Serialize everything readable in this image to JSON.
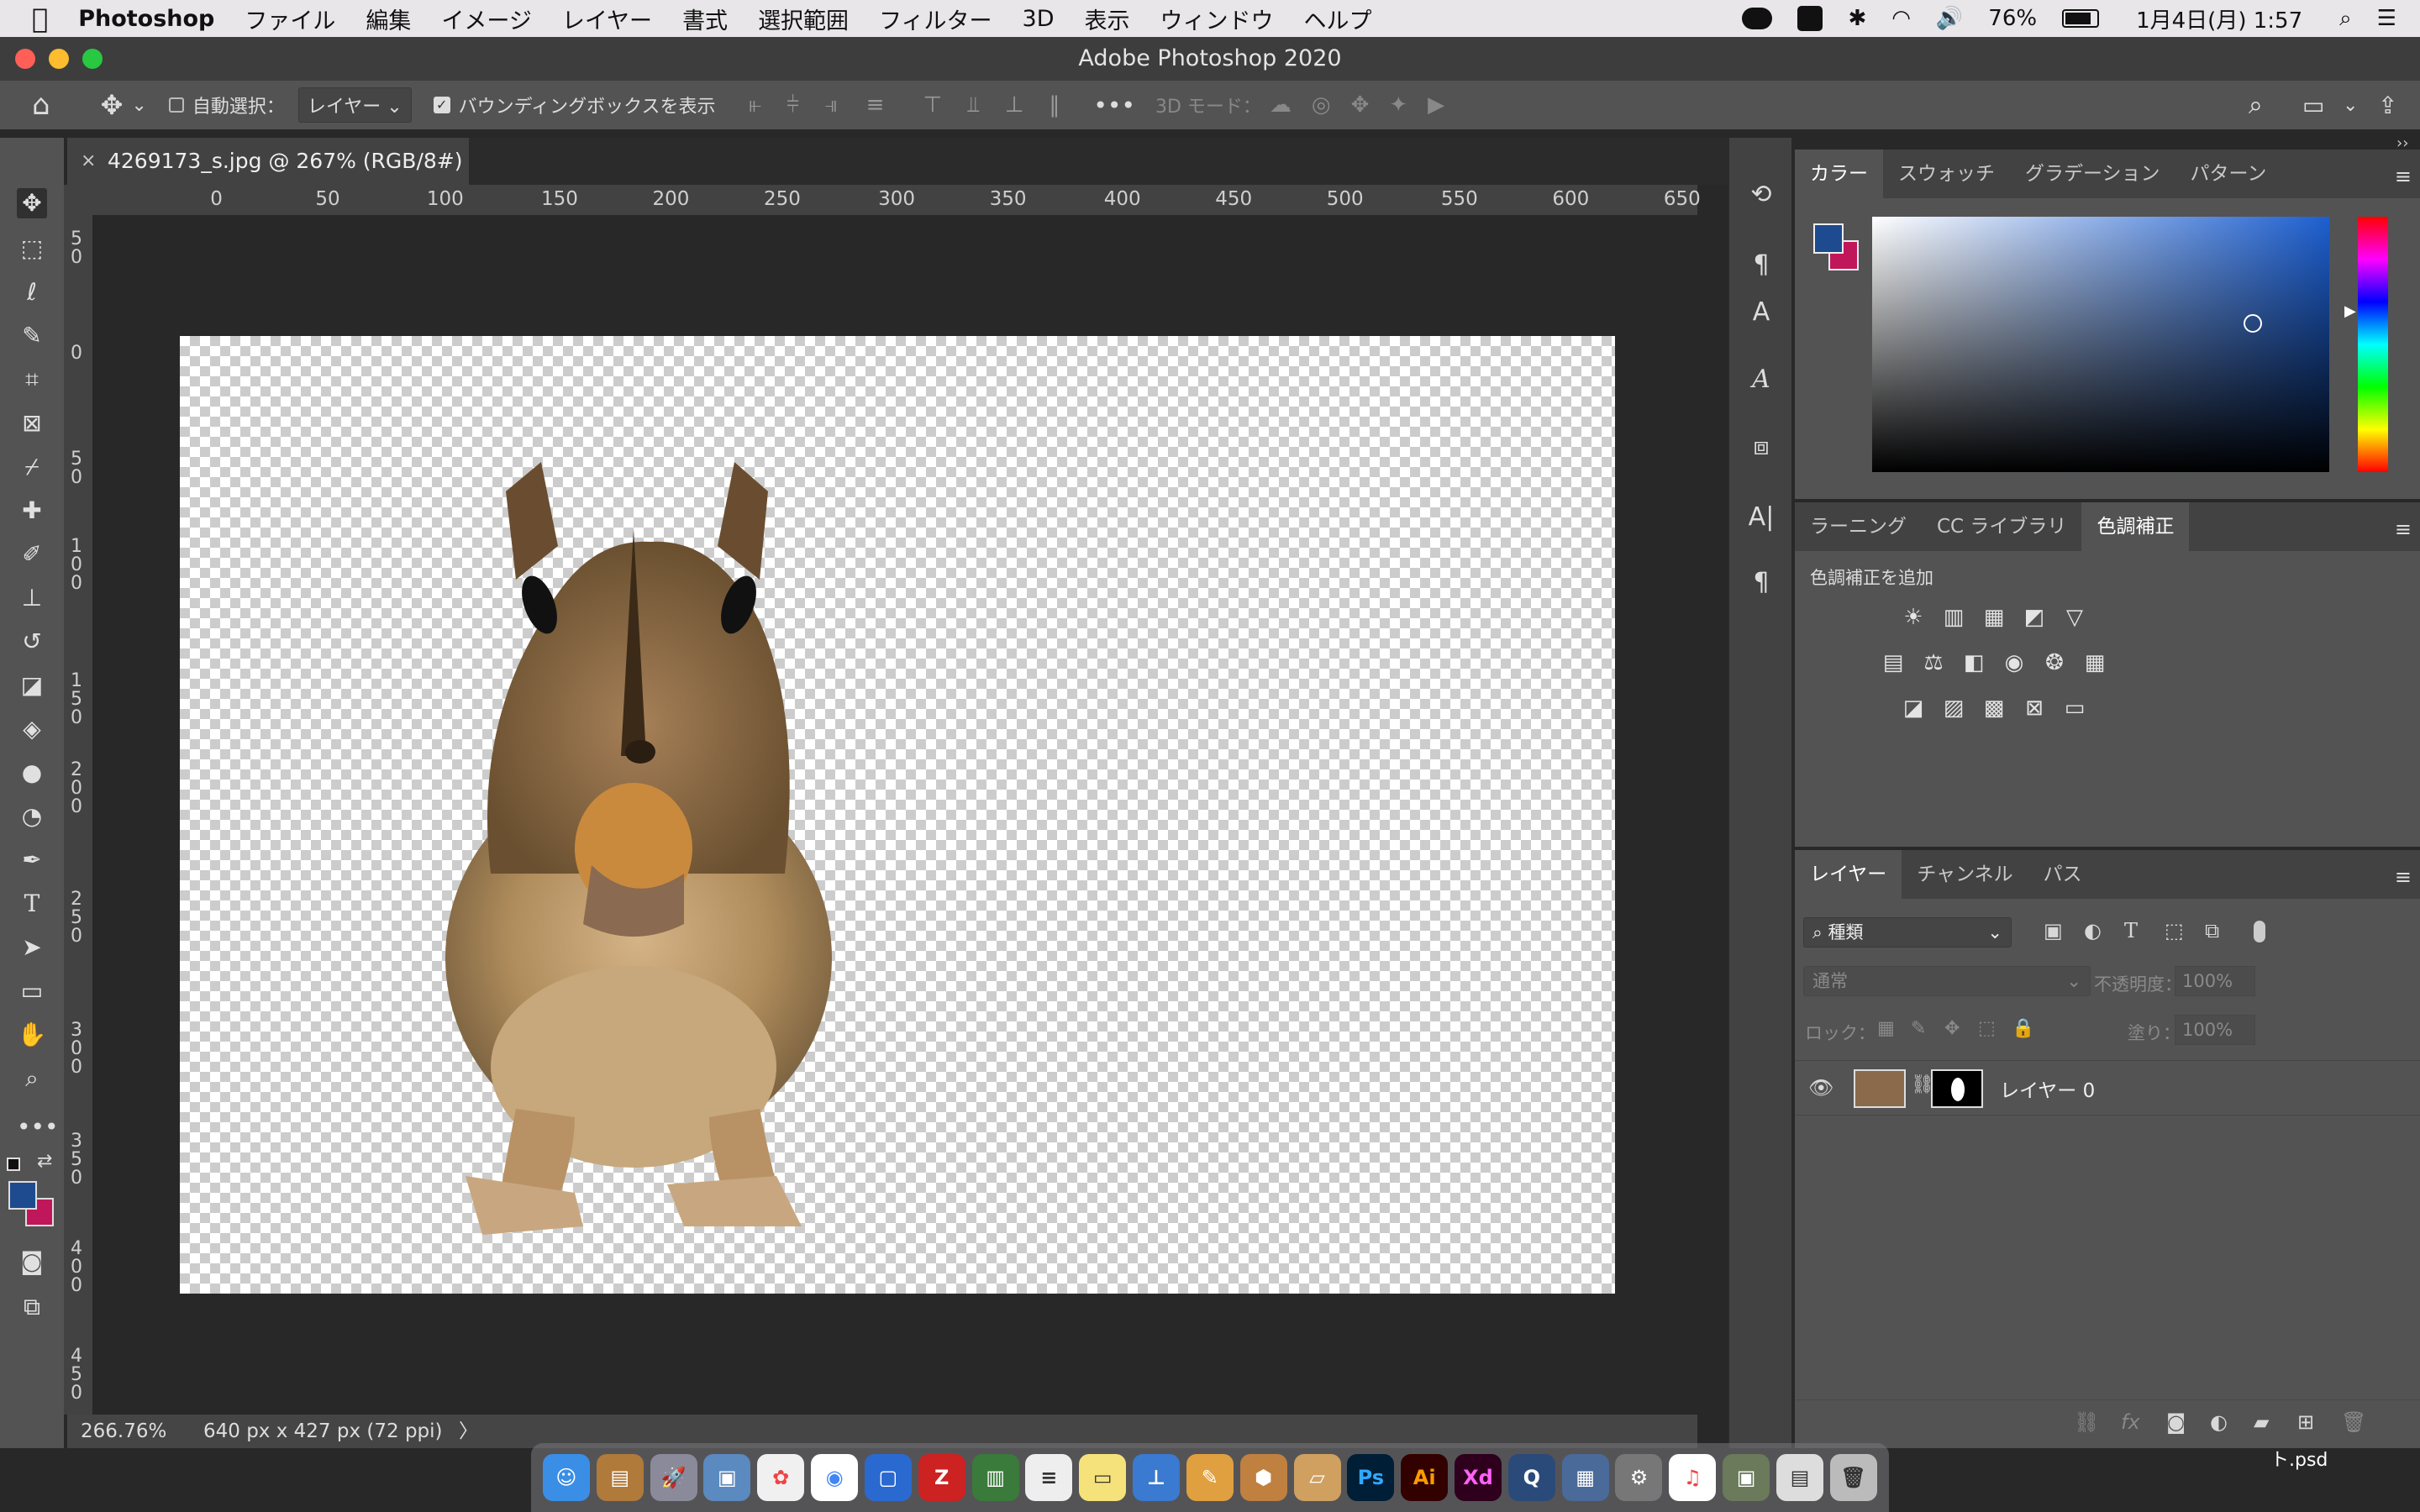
{
  "menubar": {
    "app_name": "Photoshop",
    "items": [
      "ファイル",
      "編集",
      "イメージ",
      "レイヤー",
      "書式",
      "選択範囲",
      "フィルター",
      "3D",
      "表示",
      "ウィンドウ",
      "ヘルプ"
    ],
    "battery": "76%",
    "datetime": "1月4日(月)  1:57"
  },
  "window": {
    "title": "Adobe Photoshop 2020"
  },
  "options": {
    "auto_select_label": "自動選択：",
    "auto_select_value": "レイヤー",
    "bounding_box_label": "バウンディングボックスを表示",
    "mode_3d_label": "3D モード："
  },
  "document": {
    "tab_title": "4269173_s.jpg @ 267% (RGB/8#) *",
    "zoom": "266.76%",
    "dimensions": "640 px x 427 px (72 ppi)"
  },
  "rulers": {
    "horizontal": [
      "0",
      "50",
      "100",
      "150",
      "200",
      "250",
      "300",
      "350",
      "400",
      "450",
      "500",
      "550",
      "600",
      "650"
    ],
    "vertical": [
      "5\n0",
      "0",
      "5\n0",
      "1\n0\n0",
      "1\n5\n0",
      "2\n0\n0",
      "2\n5\n0",
      "3\n0\n0",
      "3\n5\n0",
      "4\n0\n0",
      "4\n5\n0"
    ]
  },
  "colors": {
    "foreground": "#1e4a8f",
    "background": "#c0175a"
  },
  "color_panel": {
    "tabs": [
      "カラー",
      "スウォッチ",
      "グラデーション",
      "パターン"
    ],
    "active_tab": "カラー"
  },
  "adjust_panel": {
    "tabs": [
      "ラーニング",
      "CC ライブラリ",
      "色調補正"
    ],
    "active_tab": "色調補正",
    "add_label": "色調補正を追加"
  },
  "layers_panel": {
    "tabs": [
      "レイヤー",
      "チャンネル",
      "パス"
    ],
    "active_tab": "レイヤー",
    "filter_kind": "種類",
    "blend_mode": "通常",
    "opacity_label": "不透明度：",
    "opacity_value": "100%",
    "lock_label": "ロック：",
    "fill_label": "塗り：",
    "fill_value": "100%",
    "layers": [
      {
        "name": "レイヤー 0",
        "visible": true
      }
    ]
  },
  "desktop": {
    "file_label": "ト.psd"
  }
}
